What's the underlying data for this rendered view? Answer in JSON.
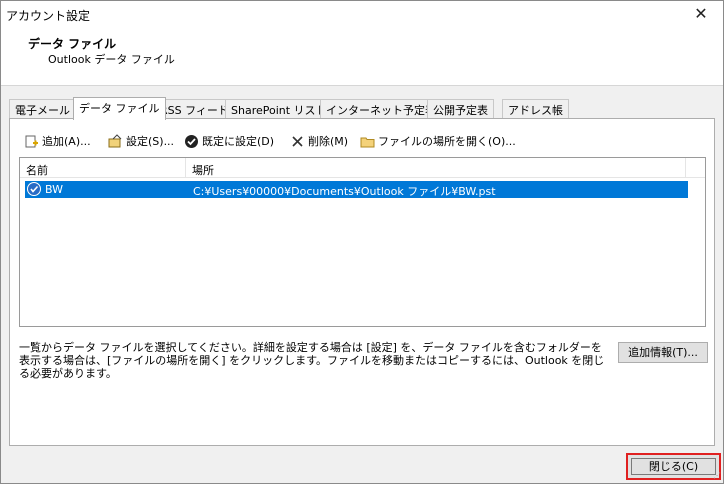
{
  "window": {
    "title": "アカウント設定",
    "close_glyph": "✕"
  },
  "header": {
    "title": "データ ファイル",
    "subtitle": "Outlook データ ファイル"
  },
  "tabs": [
    {
      "label": "電子メール"
    },
    {
      "label": "データ ファイル"
    },
    {
      "label": "RSS フィード"
    },
    {
      "label": "SharePoint リスト"
    },
    {
      "label": "インターネット予定表"
    },
    {
      "label": "公開予定表"
    },
    {
      "label": "アドレス帳"
    }
  ],
  "toolbar": {
    "add": "追加(A)...",
    "settings": "設定(S)...",
    "set_default": "既定に設定(D)",
    "remove": "削除(M)",
    "open_location": "ファイルの場所を開く(O)..."
  },
  "list": {
    "columns": [
      "名前",
      "場所"
    ],
    "rows": [
      {
        "name": "BW",
        "location": "C:¥Users¥00000¥Documents¥Outlook ファイル¥BW.pst",
        "selected": true
      }
    ]
  },
  "description": "一覧からデータ ファイルを選択してください。詳細を設定する場合は [設定] を、データ ファイルを含むフォルダーを表示する場合は、[ファイルの場所を開く] をクリックします。ファイルを移動またはコピーするには、Outlook を閉じる必要があります。",
  "buttons": {
    "more_info": "追加情報(T)...",
    "close": "閉じる(C)"
  },
  "colors": {
    "selection": "#0078d7",
    "highlight_border": "#e02020"
  }
}
